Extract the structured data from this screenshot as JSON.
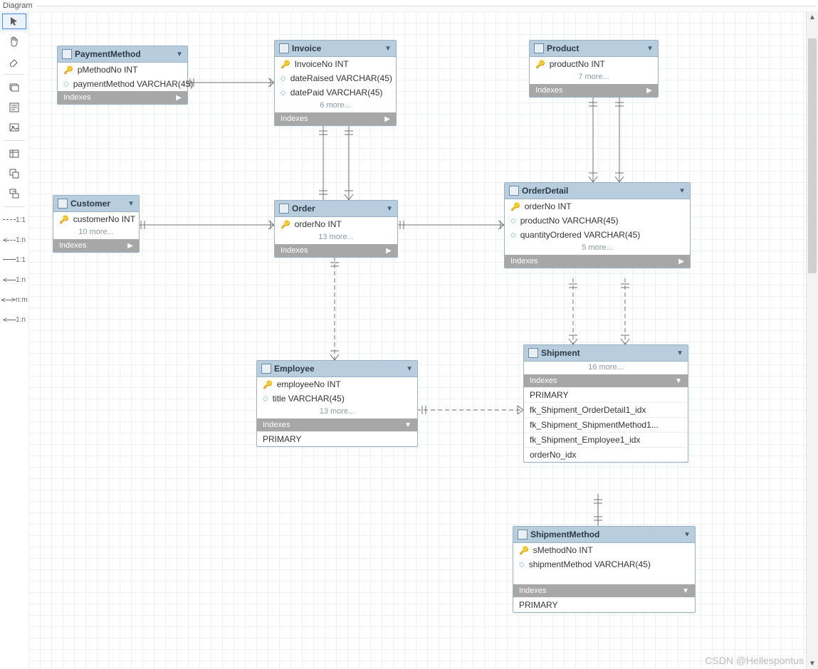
{
  "header": {
    "title": "Diagram"
  },
  "watermark": "CSDN @Hellespontus",
  "toolbox": {
    "labels": {
      "rel_11i": "1:1",
      "rel_1ni": "1:n",
      "rel_11n": "1:1",
      "rel_1nn": "1:n",
      "rel_nm": "n:m",
      "rel_1n2": "1:n"
    }
  },
  "entities": {
    "payment": {
      "title": "PaymentMethod",
      "fields": [
        {
          "icon": "key",
          "text": "pMethodNo INT"
        },
        {
          "icon": "dia",
          "text": "paymentMethod VARCHAR(45)"
        }
      ],
      "indexes_label": "Indexes"
    },
    "invoice": {
      "title": "Invoice",
      "fields": [
        {
          "icon": "key",
          "text": "InvoiceNo INT"
        },
        {
          "icon": "dia",
          "text": "dateRaised VARCHAR(45)"
        },
        {
          "icon": "dia",
          "text": "datePaid VARCHAR(45)"
        }
      ],
      "more": "6 more...",
      "indexes_label": "Indexes"
    },
    "product": {
      "title": "Product",
      "fields": [
        {
          "icon": "key",
          "text": "productNo INT"
        }
      ],
      "more": "7 more...",
      "indexes_label": "Indexes"
    },
    "customer": {
      "title": "Customer",
      "fields": [
        {
          "icon": "key",
          "text": "customerNo INT"
        }
      ],
      "more": "10 more...",
      "indexes_label": "Indexes"
    },
    "order": {
      "title": "Order",
      "fields": [
        {
          "icon": "key",
          "text": "orderNo INT"
        }
      ],
      "more": "13 more...",
      "indexes_label": "Indexes"
    },
    "orderdetail": {
      "title": "OrderDetail",
      "fields": [
        {
          "icon": "key",
          "text": "orderNo INT"
        },
        {
          "icon": "dia",
          "text": "productNo VARCHAR(45)"
        },
        {
          "icon": "dia",
          "text": "quantityOrdered VARCHAR(45)"
        }
      ],
      "more": "5 more...",
      "indexes_label": "Indexes"
    },
    "employee": {
      "title": "Employee",
      "fields": [
        {
          "icon": "key",
          "text": "employeeNo INT"
        },
        {
          "icon": "dia",
          "text": "title VARCHAR(45)"
        }
      ],
      "more": "13 more...",
      "indexes_label": "Indexes",
      "index_rows": [
        "PRIMARY"
      ]
    },
    "shipment": {
      "title": "Shipment",
      "more": "16 more...",
      "indexes_label": "Indexes",
      "index_rows": [
        "PRIMARY",
        "fk_Shipment_OrderDetail1_idx",
        "fk_Shipment_ShipmentMethod1...",
        "fk_Shipment_Employee1_idx",
        "orderNo_idx"
      ]
    },
    "shipmethod": {
      "title": "ShipmentMethod",
      "fields": [
        {
          "icon": "key",
          "text": "sMethodNo INT"
        },
        {
          "icon": "dia",
          "text": "shipmentMethod VARCHAR(45)"
        }
      ],
      "indexes_label": "Indexes",
      "index_rows": [
        "PRIMARY"
      ]
    }
  }
}
